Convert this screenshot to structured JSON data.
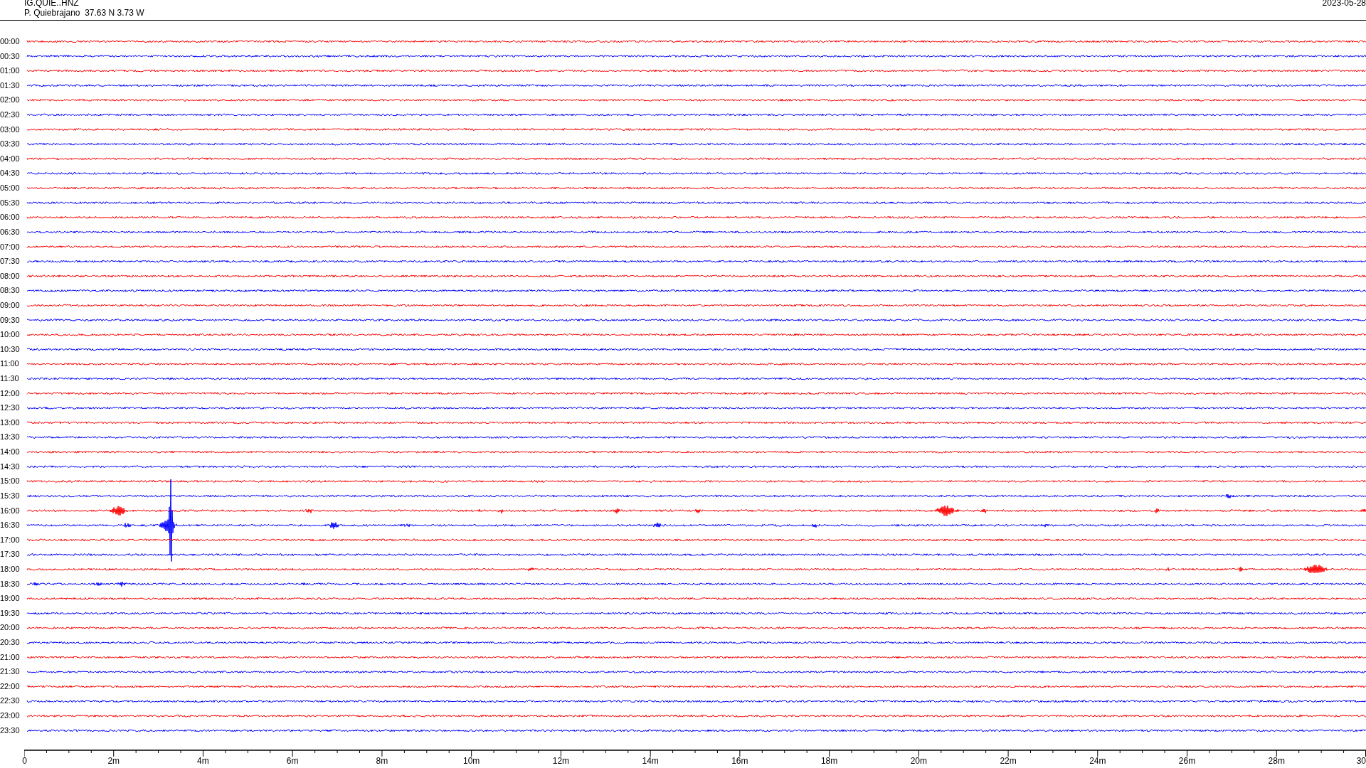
{
  "header": {
    "channel": "IG.QUIE..HNZ",
    "station": "P. Quiebrajano  37.63 N 3.73 W",
    "date": "2023-05-28"
  },
  "rows": [
    {
      "label": "00:00",
      "color": "#ff0000"
    },
    {
      "label": "00:30",
      "color": "#0000ff"
    },
    {
      "label": "01:00",
      "color": "#ff0000"
    },
    {
      "label": "01:30",
      "color": "#0000ff"
    },
    {
      "label": "02:00",
      "color": "#ff0000"
    },
    {
      "label": "02:30",
      "color": "#0000ff"
    },
    {
      "label": "03:00",
      "color": "#ff0000"
    },
    {
      "label": "03:30",
      "color": "#0000ff"
    },
    {
      "label": "04:00",
      "color": "#ff0000"
    },
    {
      "label": "04:30",
      "color": "#0000ff"
    },
    {
      "label": "05:00",
      "color": "#ff0000"
    },
    {
      "label": "05:30",
      "color": "#0000ff"
    },
    {
      "label": "06:00",
      "color": "#ff0000"
    },
    {
      "label": "06:30",
      "color": "#0000ff"
    },
    {
      "label": "07:00",
      "color": "#ff0000"
    },
    {
      "label": "07:30",
      "color": "#0000ff"
    },
    {
      "label": "08:00",
      "color": "#ff0000"
    },
    {
      "label": "08:30",
      "color": "#0000ff"
    },
    {
      "label": "09:00",
      "color": "#ff0000"
    },
    {
      "label": "09:30",
      "color": "#0000ff"
    },
    {
      "label": "10:00",
      "color": "#ff0000"
    },
    {
      "label": "10:30",
      "color": "#0000ff"
    },
    {
      "label": "11:00",
      "color": "#ff0000"
    },
    {
      "label": "11:30",
      "color": "#0000ff"
    },
    {
      "label": "12:00",
      "color": "#ff0000"
    },
    {
      "label": "12:30",
      "color": "#0000ff"
    },
    {
      "label": "13:00",
      "color": "#ff0000"
    },
    {
      "label": "13:30",
      "color": "#0000ff"
    },
    {
      "label": "14:00",
      "color": "#ff0000"
    },
    {
      "label": "14:30",
      "color": "#0000ff"
    },
    {
      "label": "15:00",
      "color": "#ff0000"
    },
    {
      "label": "15:30",
      "color": "#0000ff"
    },
    {
      "label": "16:00",
      "color": "#ff0000"
    },
    {
      "label": "16:30",
      "color": "#0000ff"
    },
    {
      "label": "17:00",
      "color": "#ff0000"
    },
    {
      "label": "17:30",
      "color": "#0000ff"
    },
    {
      "label": "18:00",
      "color": "#ff0000"
    },
    {
      "label": "18:30",
      "color": "#0000ff"
    },
    {
      "label": "19:00",
      "color": "#ff0000"
    },
    {
      "label": "19:30",
      "color": "#0000ff"
    },
    {
      "label": "20:00",
      "color": "#ff0000"
    },
    {
      "label": "20:30",
      "color": "#0000ff"
    },
    {
      "label": "21:00",
      "color": "#ff0000"
    },
    {
      "label": "21:30",
      "color": "#0000ff"
    },
    {
      "label": "22:00",
      "color": "#ff0000"
    },
    {
      "label": "22:30",
      "color": "#0000ff"
    },
    {
      "label": "23:00",
      "color": "#ff0000"
    },
    {
      "label": "23:30",
      "color": "#0000ff"
    }
  ],
  "time_axis": {
    "labels": [
      "0",
      "2m",
      "4m",
      "6m",
      "8m",
      "10m",
      "12m",
      "14m",
      "16m",
      "18m",
      "20m",
      "22m",
      "24m",
      "26m",
      "28m",
      "30"
    ]
  }
}
